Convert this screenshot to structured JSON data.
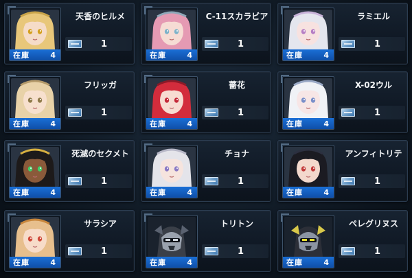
{
  "stock_label": "在庫",
  "cards": [
    {
      "name": "天香のヒルメ",
      "stock": "4",
      "count": "1",
      "hair": "#e8c77a",
      "skin": "#f5dcc8",
      "accent": "#c9a44a",
      "eyes": "#d4a020",
      "portrait_icon": "blonde-girl-portrait"
    },
    {
      "name": "C-11スカラビア",
      "stock": "4",
      "count": "1",
      "hair": "#e59ab3",
      "skin": "#f6dcd4",
      "accent": "#8fa7b8",
      "eyes": "#7db3c9",
      "portrait_icon": "pink-hair-girl-portrait"
    },
    {
      "name": "ラミエル",
      "stock": "4",
      "count": "1",
      "hair": "#e4e6ee",
      "skin": "#f7e2e0",
      "accent": "#c8b3d9",
      "eyes": "#b67ec4",
      "portrait_icon": "silver-hair-girl-portrait"
    },
    {
      "name": "フリッガ",
      "stock": "4",
      "count": "1",
      "hair": "#e8d2a8",
      "skin": "#f7e0ce",
      "accent": "#b49a6a",
      "eyes": "#8f7a4a",
      "portrait_icon": "blonde-bob-girl-portrait"
    },
    {
      "name": "薔花",
      "stock": "4",
      "count": "1",
      "hair": "#d32c3c",
      "skin": "#f7dcd2",
      "accent": "#8a1a28",
      "eyes": "#c42a3a",
      "portrait_icon": "red-hair-girl-portrait"
    },
    {
      "name": "X-02ウル",
      "stock": "4",
      "count": "1",
      "hair": "#f0f2f6",
      "skin": "#f7e6e6",
      "accent": "#9aa9c6",
      "eyes": "#7a8fc9",
      "portrait_icon": "white-hair-girl-portrait"
    },
    {
      "name": "死滅のセクメト",
      "stock": "4",
      "count": "1",
      "hair": "#1d1a1a",
      "skin": "#8a5a3a",
      "accent": "#d8b040",
      "eyes": "#3fd06a",
      "portrait_icon": "dark-skin-girl-portrait"
    },
    {
      "name": "チョナ",
      "stock": "4",
      "count": "1",
      "hair": "#e4e4ea",
      "skin": "#f6e4de",
      "accent": "#b8b8c8",
      "eyes": "#8a7ac4",
      "portrait_icon": "pale-hair-girl-portrait"
    },
    {
      "name": "アンフィトリテ",
      "stock": "4",
      "count": "1",
      "hair": "#1b1b22",
      "skin": "#f3d8cc",
      "accent": "#2c3040",
      "eyes": "#c23a3a",
      "portrait_icon": "captain-hat-girl-portrait"
    },
    {
      "name": "サラシア",
      "stock": "4",
      "count": "1",
      "hair": "#e7bf8d",
      "skin": "#f7dcc9",
      "accent": "#c9873c",
      "eyes": "#d04a3a",
      "portrait_icon": "orange-hair-girl-portrait"
    },
    {
      "name": "トリトン",
      "stock": "4",
      "count": "1",
      "hair": "#3a3f48",
      "skin": "#9aa2ae",
      "accent": "#5a6270",
      "eyes": "#cfd6de",
      "portrait_icon": "robot-head-portrait"
    },
    {
      "name": "ペレグリヌス",
      "stock": "4",
      "count": "1",
      "hair": "#2c2f38",
      "skin": "#8b94a2",
      "accent": "#d8c84a",
      "eyes": "#e8e030",
      "portrait_icon": "mecha-head-portrait"
    }
  ]
}
